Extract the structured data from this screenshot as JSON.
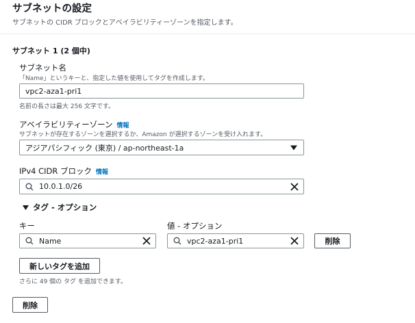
{
  "header": {
    "title": "サブネットの設定",
    "description": "サブネットの CIDR ブロックとアベイラビリティーゾーンを指定します。"
  },
  "subnet": {
    "section_title": "サブネット 1 (2 個中)",
    "name": {
      "label": "サブネット名",
      "description": "「Name」というキーと、指定した値を使用してタグを作成します。",
      "value": "vpc2-aza1-pri1",
      "hint": "名前の長さは最大 256 文字です。"
    },
    "az": {
      "label": "アベイラビリティーゾーン",
      "info": "情報",
      "description": "サブネットが存在するゾーンを選択するか、Amazon が選択するゾーンを受け入れます。",
      "selected": "アジアパシフィック (東京) / ap-northeast-1a"
    },
    "cidr": {
      "label": "IPv4 CIDR ブロック",
      "info": "情報",
      "value": "10.0.1.0/26"
    },
    "tags": {
      "toggle_label": "タグ - オプション",
      "key_label": "キー",
      "value_label": "値 - オプション",
      "key_value": "Name",
      "value_value": "vpc2-aza1-pri1",
      "remove_label": "削除",
      "add_label": "新しいタグを追加",
      "remaining": "さらに 49 個の タグ を追加できます。"
    },
    "delete_label": "削除"
  },
  "colors": {
    "link": "#0073bb",
    "border": "#879596",
    "text": "#16191f",
    "muted": "#545b64"
  }
}
